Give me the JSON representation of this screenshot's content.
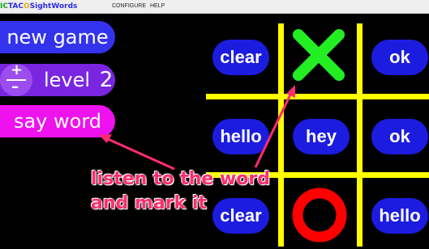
{
  "app": {
    "title_parts": [
      {
        "text": "IC",
        "color": "#1aa31a"
      },
      {
        "text": "TAC",
        "color": "#2a2ae8"
      },
      {
        "text": "O",
        "color": "#e8b000"
      },
      {
        "text": "SightWords",
        "color": "#2a2ae8"
      }
    ]
  },
  "menu": {
    "configure": "CONFIGURE",
    "help": "HELP"
  },
  "controls": {
    "new_game": "new game",
    "level_label": "level",
    "level_value": "2",
    "level_plus": "+",
    "level_minus": "–",
    "say_word": "say word"
  },
  "board": {
    "cells": [
      {
        "word": "clear",
        "mark": ""
      },
      {
        "word": "",
        "mark": "X"
      },
      {
        "word": "ok",
        "mark": ""
      },
      {
        "word": "hello",
        "mark": ""
      },
      {
        "word": "hey",
        "mark": ""
      },
      {
        "word": "ok",
        "mark": ""
      },
      {
        "word": "clear",
        "mark": ""
      },
      {
        "word": "",
        "mark": "O"
      },
      {
        "word": "hello",
        "mark": ""
      }
    ],
    "colors": {
      "grid": "#ffff00",
      "tile": "#1c1ce0",
      "x_mark": "#22ee22",
      "o_mark": "#ff0000"
    }
  },
  "annotation": {
    "line1": "listen to the word",
    "line2": "and mark it",
    "color": "#ff2d6f"
  }
}
